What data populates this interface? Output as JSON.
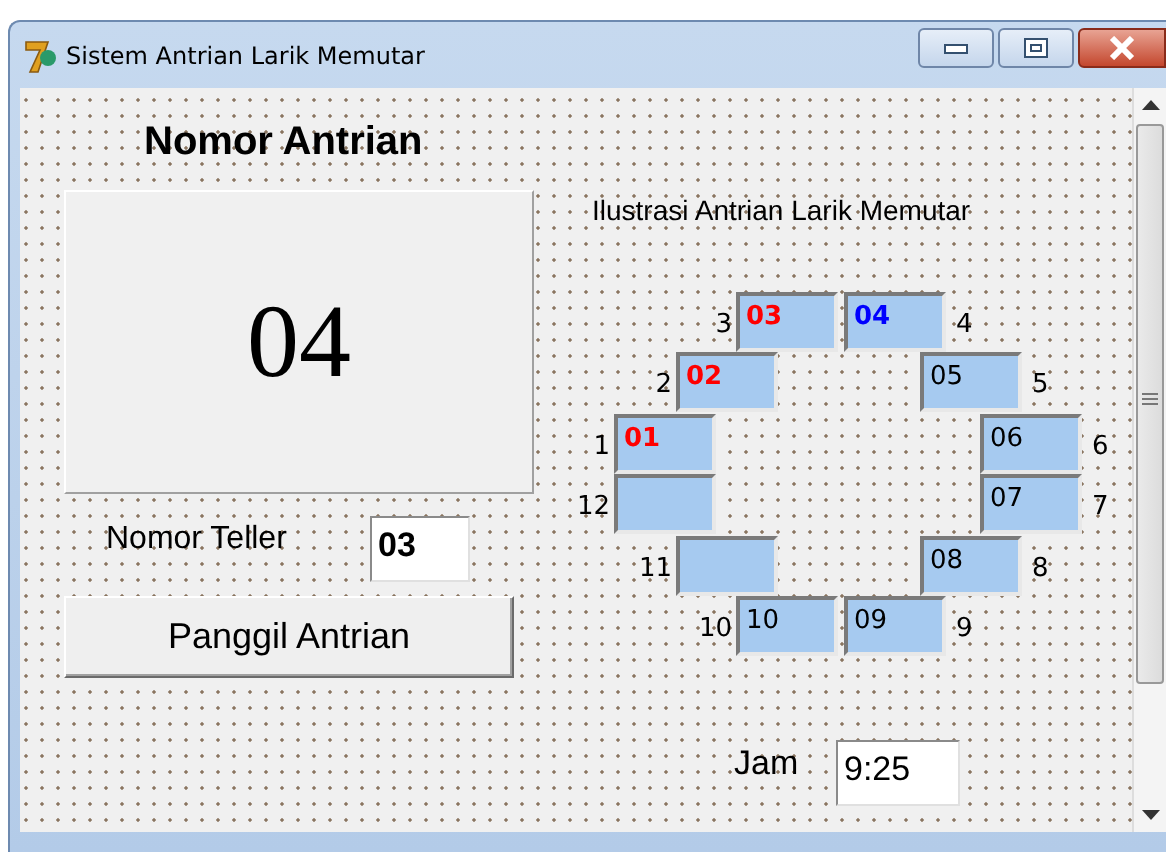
{
  "window": {
    "title": "Sistem Antrian Larik Memutar"
  },
  "heading": "Nomor Antrian",
  "current_number": "04",
  "teller": {
    "label": "Nomor Teller",
    "value": "03"
  },
  "call_button": "Panggil Antrian",
  "illustration": {
    "title": "Ilustrasi Antrian Larik Memutar",
    "slots": [
      {
        "number": "1",
        "value": "01",
        "color": "#ff0000",
        "bold": true
      },
      {
        "number": "2",
        "value": "02",
        "color": "#ff0000",
        "bold": true
      },
      {
        "number": "3",
        "value": "03",
        "color": "#ff0000",
        "bold": true
      },
      {
        "number": "4",
        "value": "04",
        "color": "#0000ff",
        "bold": true
      },
      {
        "number": "5",
        "value": "05",
        "color": "#000000",
        "bold": false
      },
      {
        "number": "6",
        "value": "06",
        "color": "#000000",
        "bold": false
      },
      {
        "number": "7",
        "value": "07",
        "color": "#000000",
        "bold": false
      },
      {
        "number": "8",
        "value": "08",
        "color": "#000000",
        "bold": false
      },
      {
        "number": "9",
        "value": "09",
        "color": "#000000",
        "bold": false
      },
      {
        "number": "10",
        "value": "10",
        "color": "#000000",
        "bold": false
      },
      {
        "number": "11"
      },
      {
        "number": "12"
      }
    ]
  },
  "clock": {
    "label": "Jam",
    "value": "9:25"
  }
}
